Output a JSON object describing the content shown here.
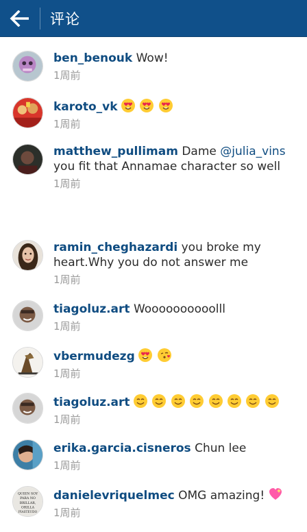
{
  "header": {
    "title": "评论",
    "back_icon": "arrow-left-icon",
    "color": "#10508a"
  },
  "comments": [
    {
      "user": "ben_benouk",
      "text": "Wow!",
      "time": "1周前",
      "emoji": []
    },
    {
      "user": "karoto_vk",
      "text": "",
      "time": "1周前",
      "emoji": [
        "heart-eyes",
        "heart-eyes",
        "heart-eyes"
      ]
    },
    {
      "user": "matthew_pullimam",
      "text_pre": "Dame ",
      "mention": "@julia_vins",
      "text_post": " you fit that Annamae character so well",
      "time": "1周前",
      "emoji": []
    },
    {
      "user": "ramin_cheghazardi",
      "text": "you broke my heart.Why you do not answer me",
      "time": "1周前",
      "emoji": []
    },
    {
      "user": "tiagoluz.art",
      "text": "Woooooooooolll",
      "time": "1周前",
      "emoji": []
    },
    {
      "user": "vbermudezg",
      "text": "",
      "time": "1周前",
      "emoji": [
        "heart-eyes",
        "kissing-heart"
      ]
    },
    {
      "user": "tiagoluz.art",
      "text": "",
      "time": "1周前",
      "emoji": [
        "smile",
        "smile",
        "smile",
        "smile",
        "smile",
        "smile",
        "smile",
        "smile"
      ]
    },
    {
      "user": "erika.garcia.cisneros",
      "text": "Chun lee",
      "time": "1周前",
      "emoji": []
    },
    {
      "user": "danielevriquelmec",
      "text": "OMG amazing!",
      "time": "1周前",
      "emoji": [
        "sparkling-heart"
      ]
    }
  ],
  "avatar_text": "QUIEN SOY PARA NO BRILLAR, ORILLA PIASTEUDO"
}
